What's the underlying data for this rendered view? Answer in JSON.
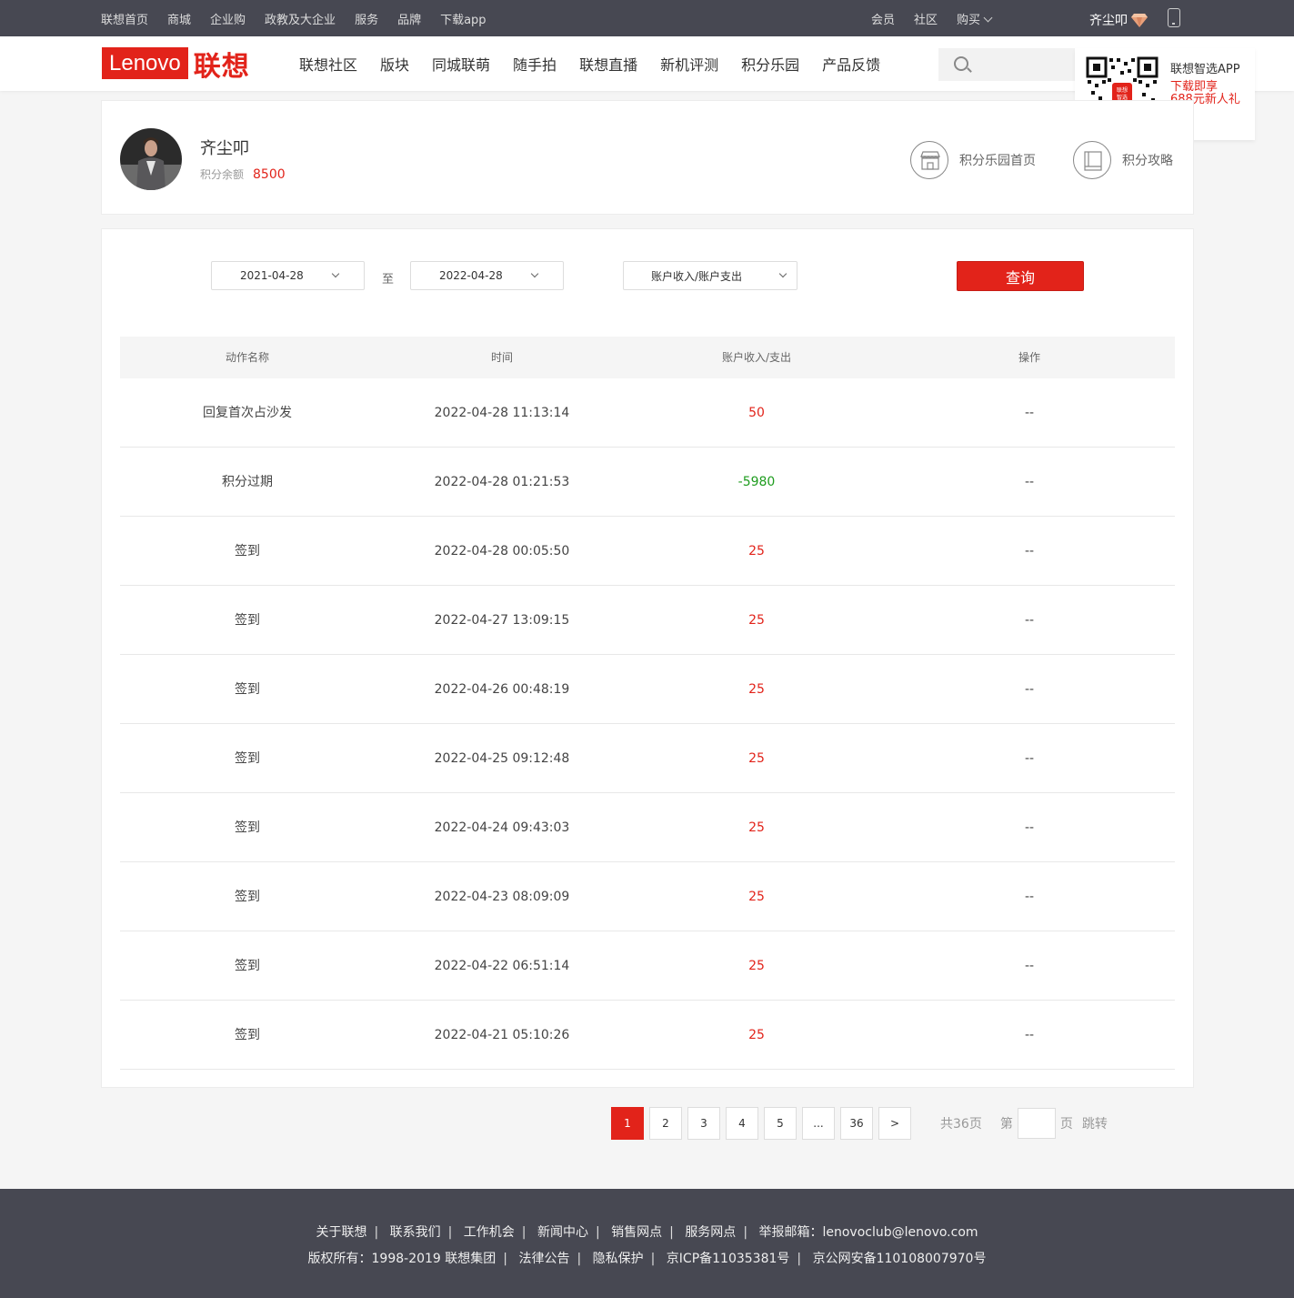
{
  "topbar": {
    "left_links": [
      "联想首页",
      "商城",
      "企业购",
      "政教及大企业",
      "服务",
      "品牌",
      "下载app"
    ],
    "right_links": [
      "会员",
      "社区",
      "购买"
    ],
    "username": "齐尘叩"
  },
  "header": {
    "logo_en": "Lenovo",
    "logo_cn": "联想",
    "nav": [
      "联想社区",
      "版块",
      "同城联萌",
      "随手拍",
      "联想直播",
      "新机评测",
      "积分乐园",
      "产品反馈"
    ]
  },
  "qr_popup": {
    "title": "联想智选APP",
    "promo_line1": "下载即享",
    "promo_line2": "688元新人礼",
    "badge": "联想智选"
  },
  "profile": {
    "name": "齐尘叩",
    "balance_label": "积分余额",
    "balance_value": "8500",
    "links": [
      "积分乐园首页",
      "积分攻略"
    ]
  },
  "filter": {
    "start_date": "2021-04-28",
    "to_label": "至",
    "end_date": "2022-04-28",
    "type": "账户收入/账户支出",
    "query_label": "查询"
  },
  "table": {
    "headers": [
      "动作名称",
      "时间",
      "账户收入/支出",
      "操作"
    ],
    "rows": [
      {
        "action": "回复首次占沙发",
        "time": "2022-04-28 11:13:14",
        "amount": "50",
        "op": "--"
      },
      {
        "action": "积分过期",
        "time": "2022-04-28 01:21:53",
        "amount": "-5980",
        "op": "--"
      },
      {
        "action": "签到",
        "time": "2022-04-28 00:05:50",
        "amount": "25",
        "op": "--"
      },
      {
        "action": "签到",
        "time": "2022-04-27 13:09:15",
        "amount": "25",
        "op": "--"
      },
      {
        "action": "签到",
        "time": "2022-04-26 00:48:19",
        "amount": "25",
        "op": "--"
      },
      {
        "action": "签到",
        "time": "2022-04-25 09:12:48",
        "amount": "25",
        "op": "--"
      },
      {
        "action": "签到",
        "time": "2022-04-24 09:43:03",
        "amount": "25",
        "op": "--"
      },
      {
        "action": "签到",
        "time": "2022-04-23 08:09:09",
        "amount": "25",
        "op": "--"
      },
      {
        "action": "签到",
        "time": "2022-04-22 06:51:14",
        "amount": "25",
        "op": "--"
      },
      {
        "action": "签到",
        "time": "2022-04-21 05:10:26",
        "amount": "25",
        "op": "--"
      }
    ]
  },
  "pagination": {
    "pages": [
      "1",
      "2",
      "3",
      "4",
      "5",
      "...",
      "36",
      ">"
    ],
    "current": "1",
    "total_text": "共36页",
    "goto_prefix": "第",
    "goto_suffix": "页",
    "jump_label": "跳转"
  },
  "footer": {
    "links": [
      "关于联想",
      "联系我们",
      "工作机会",
      "新闻中心",
      "销售网点",
      "服务网点",
      "举报邮箱：lenovoclub@lenovo.com"
    ],
    "copyright": [
      "版权所有：1998-2019 联想集团",
      "法律公告",
      "隐私保护",
      "京ICP备11035381号",
      "京公网安备110108007970号"
    ]
  },
  "colors": {
    "brand_red": "#e2231a",
    "positive": "#e2231a",
    "negative": "#1e9c1e",
    "topbar_bg": "#474852"
  }
}
